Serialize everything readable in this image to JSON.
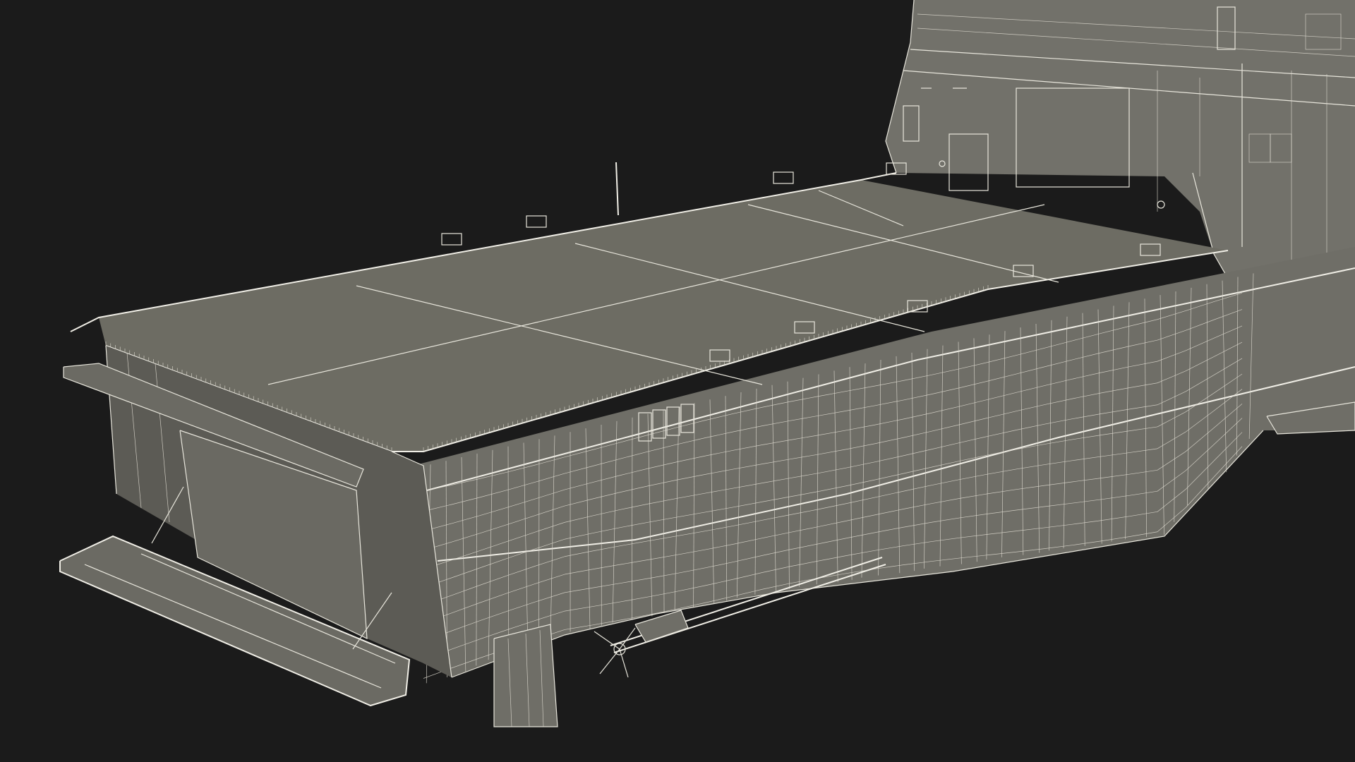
{
  "scene": {
    "subject": "ship-stern-wireframe",
    "background_color": "#1b1b1b",
    "surface_color": "#6f6e67",
    "wire_color": "#e8e6dc"
  }
}
